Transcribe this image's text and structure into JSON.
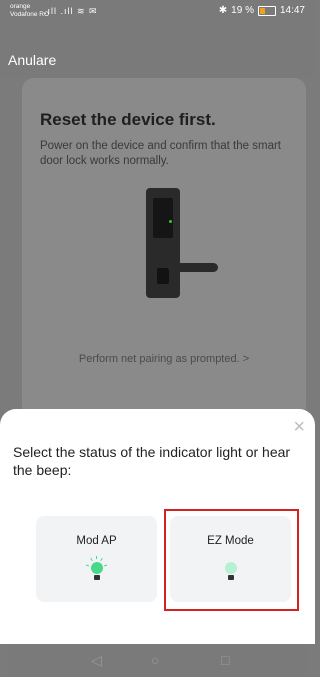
{
  "status_bar": {
    "carrier_line1": "orange",
    "carrier_line2": "Vodafone RO",
    "battery_text": "19 %",
    "time": "14:47"
  },
  "header": {
    "cancel_label": "Anulare"
  },
  "card": {
    "title": "Reset the device first.",
    "description": "Power on the device and confirm that the smart door lock works normally.",
    "pairing_link": "Perform net pairing as prompted. >"
  },
  "sheet": {
    "prompt": "Select the status of the indicator light or hear the beep:",
    "options": [
      {
        "label": "Mod AP",
        "icon": "bulb-bright-icon"
      },
      {
        "label": "EZ Mode",
        "icon": "bulb-dim-icon"
      }
    ]
  },
  "colors": {
    "accent_green": "#46d98a",
    "highlight_red": "#d32222"
  }
}
